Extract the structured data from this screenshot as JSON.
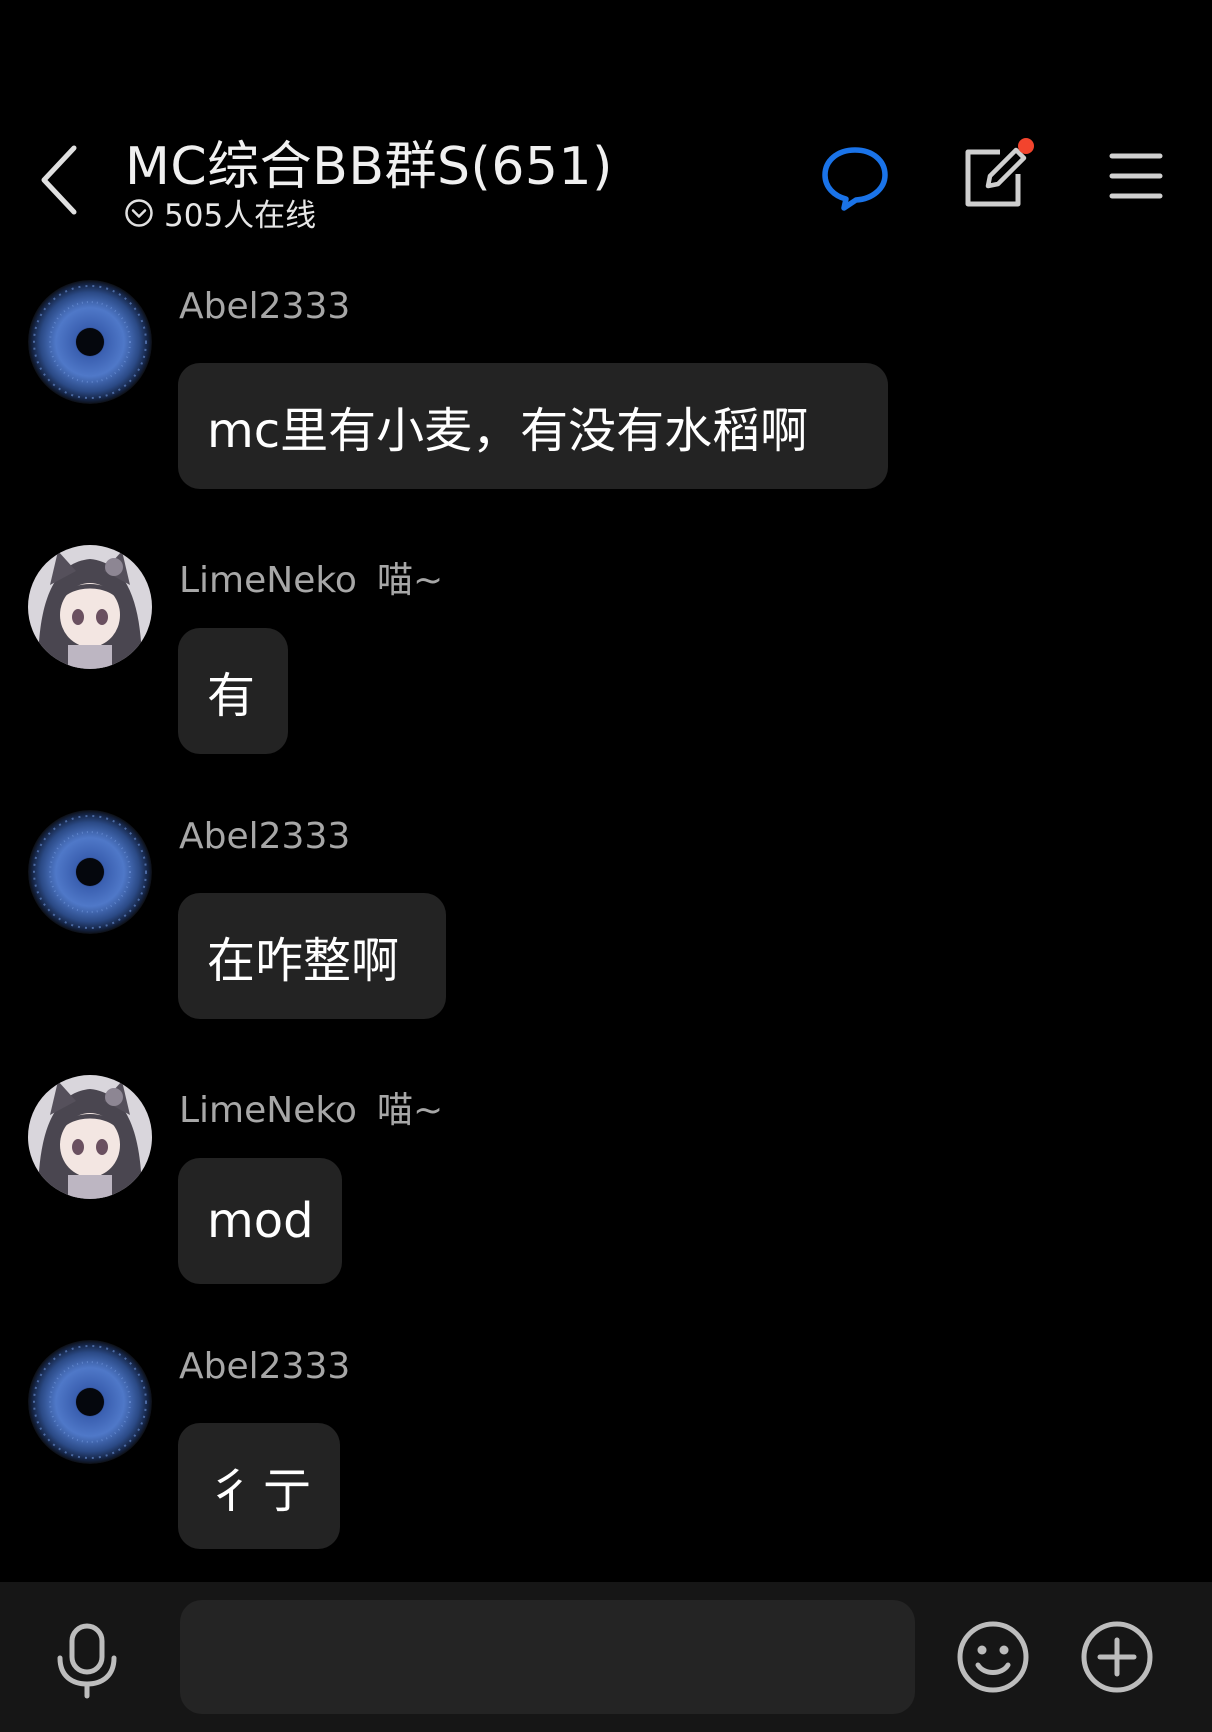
{
  "header": {
    "title": "MC综合BB群S(651)",
    "online_status": "505人在线",
    "accent_color": "#1a73e8",
    "badge_color": "#f2442d",
    "icons": [
      "back-arrow-icon",
      "chat-bubble-icon",
      "edit-icon",
      "menu-icon"
    ]
  },
  "messages": [
    {
      "sender": "Abel2333",
      "tag": "",
      "text": "mc里有小麦，有没有水稻啊",
      "avatar": "blue-eye"
    },
    {
      "sender": "LimeNeko",
      "tag": "喵~",
      "text": "有",
      "avatar": "anime-girl"
    },
    {
      "sender": "Abel2333",
      "tag": "",
      "text": "在咋整啊",
      "avatar": "blue-eye"
    },
    {
      "sender": "LimeNeko",
      "tag": "喵~",
      "text": "mod",
      "avatar": "anime-girl"
    },
    {
      "sender": "Abel2333",
      "tag": "",
      "text": "彳亍",
      "avatar": "blue-eye"
    }
  ],
  "input_bar": {
    "placeholder": "",
    "icons": [
      "microphone-icon",
      "emoji-icon",
      "add-icon"
    ]
  }
}
